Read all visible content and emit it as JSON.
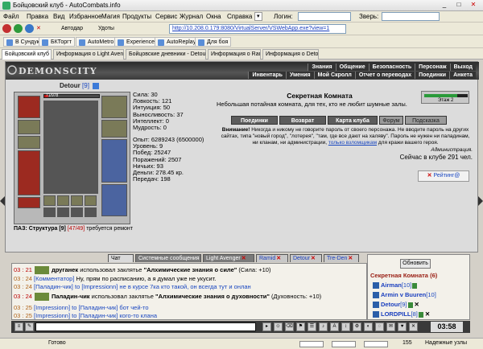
{
  "window": {
    "title": "Бойцовский клуб - AutoCombats.info",
    "min": "_",
    "max": "□",
    "close": "✕"
  },
  "menu": {
    "items": [
      "Файл",
      "Правка",
      "Вид",
      "Избранное",
      "Магия",
      "Продукты",
      "Сервис",
      "Журнал",
      "Окна",
      "Справка"
    ],
    "login_label": "Логин:",
    "beast_label": "Зверь:"
  },
  "nav": {
    "close_all": "✕",
    "autodar": "Автодар",
    "flasks": "Удоты",
    "url": "http://10.208.0.179:8080/VirtualServer/VSWebApp.exe?view=1"
  },
  "links": [
    "В Сундук",
    "БКТоргт",
    "AutoMetro",
    "Experience",
    "AutoReplay",
    "Для боя"
  ],
  "tabs": [
    "Бойцовский клуб",
    "Информация о Light Avenger",
    "Бойцовские дневники - Detour ...",
    "Информация о Ramid",
    "Информация о Detour"
  ],
  "game": {
    "logo": "DEMONSCITY",
    "nav_row1": [
      "Знания",
      "Общение",
      "Безопасность",
      "Персонаж",
      "Выход"
    ],
    "nav_row2": [
      "Инвентарь",
      "Умения",
      "Мой Скролл",
      "Отчет о переводах",
      "Поединки",
      "Анкета"
    ],
    "character": {
      "name": "Detour",
      "level": "[9]",
      "hp": "71/978",
      "hp_fraction": 0.07,
      "structure_label": "ПАЗ: Структура [9]",
      "structure_value": "[47/49]",
      "structure_warning": "требуется ремонт"
    },
    "stats": [
      "Сила: 30",
      "Ловкость: 121",
      "Интуиция: 50",
      "Выносливость: 37",
      "Интеллект: 0",
      "Мудрость: 0"
    ],
    "stats2": [
      "Опыт: 6289243 (6500000)",
      "Уровень: 9",
      "Побед: 25247",
      "Поражений: 2507",
      "Ничьих: 93",
      "Деньги: 278.45 кр.",
      "Передач: 198"
    ],
    "room": {
      "title": "Секретная Комната",
      "desc": "Небольшая потайная комната, для тех, кто не любит шумные залы.",
      "floor": "Этаж 2",
      "map_fill": 0.75,
      "buttons": [
        "Поединки",
        "Возврат",
        "Карта клуба",
        "Форум",
        "Подсказка"
      ],
      "notice_att": "Внимание!",
      "notice": "Никогда и никому не говорите пароль от своего персонажа. Не вводите пароль на других сайтах, типа \"новый город\", \"лотерея\", \"там, где все дают на халяву\". Пароль не нужен ни паладинам, ни кланам, ни администрации,",
      "notice_link": "только взломщикам",
      "notice_end": "для кражи вашего героя.",
      "admin": "Администрация.",
      "online": "Сейчас в клубе 291 чел.",
      "rating": "Рейтинг@"
    },
    "chat_tabs": [
      "Чат",
      "Системные сообщения",
      "Light Avenger",
      "Ramid",
      "Detour",
      "Tre-Den"
    ],
    "chat_tab_close": "✕",
    "chat": [
      {
        "time": "03 : 21",
        "who": "друганек",
        "text": " использовал заклятье ",
        "spell": "\"Алхимические знания о силе\"",
        "tail": " (Сила: +10)"
      },
      {
        "time": "03 : 24",
        "who": "[Комментатор]",
        "text": " Ну, прям по расписанию, а я думал уже не укусит.",
        "spell": "",
        "tail": ""
      },
      {
        "time": "03 : 24",
        "who": "[Паладин-чик]",
        "text": " to [Impressionn] не в курсе 7ка кто такой, он всегда тут и онлан",
        "spell": "",
        "tail": ""
      },
      {
        "time": "03 : 24",
        "who": "Паладин-чик",
        "text": " использовал заклятье ",
        "spell": "\"Алхимические знания о духовности\"",
        "tail": " (Духовность: +10)"
      },
      {
        "time": "03 : 25",
        "who": "[Impressionn]",
        "text": " to [Паладин-чик] бот чей-то",
        "spell": "",
        "tail": ""
      },
      {
        "time": "03 : 25",
        "who": "[Impressionn]",
        "text": " to [Паладин-чик] кого-то клана",
        "spell": "",
        "tail": ""
      }
    ],
    "right": {
      "refresh": "Обновить",
      "room": "Секретная Комната (6)",
      "players": [
        {
          "name": "Airman",
          "lvl": "[10]"
        },
        {
          "name": "Armin v Buuren",
          "lvl": "[10]"
        },
        {
          "name": "Detour",
          "lvl": "[9]"
        },
        {
          "name": "LORDPILL",
          "lvl": "[8]"
        }
      ],
      "remove": "✕"
    },
    "clock": "03:58"
  },
  "status": {
    "ready": "Готово",
    "count": "155",
    "zone": "Надежные узлы"
  }
}
